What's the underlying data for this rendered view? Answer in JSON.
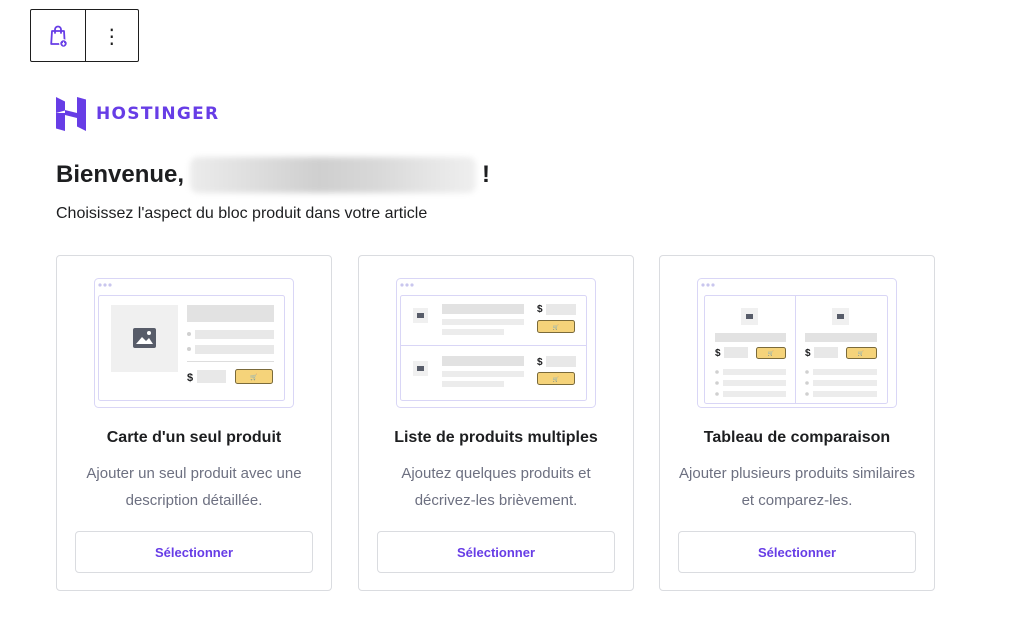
{
  "toolbar": {
    "block_icon": "shopping-bag-icon",
    "options_icon": "kebab-menu-icon",
    "options_glyph": "⋮"
  },
  "brand": {
    "name": "HOSTINGER",
    "color": "#673de6"
  },
  "welcome": {
    "prefix": "Bienvenue,",
    "suffix": "!",
    "subtitle": "Choisissez l'aspect du bloc produit dans votre article"
  },
  "cards": [
    {
      "title": "Carte d'un seul produit",
      "description": "Ajouter un seul produit avec une description détaillée.",
      "button": "Sélectionner",
      "price_symbol": "$"
    },
    {
      "title": "Liste de produits multiples",
      "description": "Ajoutez quelques produits et décrivez-les brièvement.",
      "button": "Sélectionner",
      "price_symbol": "$"
    },
    {
      "title": "Tableau de comparaison",
      "description": "Ajouter plusieurs produits similaires et comparez-les.",
      "button": "Sélectionner",
      "price_symbol": "$"
    }
  ],
  "colors": {
    "accent": "#673de6",
    "cart_button": "#f5d37a",
    "text_primary": "#1d1e20",
    "text_secondary": "#6d7081"
  }
}
